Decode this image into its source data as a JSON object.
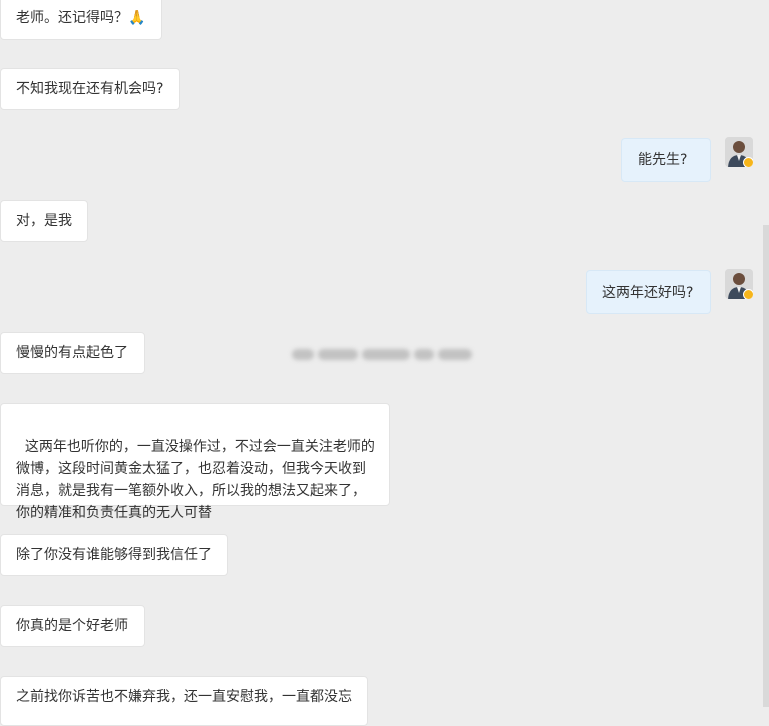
{
  "chat": {
    "messages": [
      {
        "side": "left",
        "text": "老师。还记得吗？🙏"
      },
      {
        "side": "left",
        "text": "不知我现在还有机会吗?"
      },
      {
        "side": "right",
        "text": "能先生?"
      },
      {
        "side": "left",
        "text": "对，是我"
      },
      {
        "side": "right",
        "text": "这两年还好吗?"
      },
      {
        "side": "left",
        "text": "慢慢的有点起色了"
      },
      {
        "side": "left",
        "text": "这两年也听你的，一直没操作过，不过会一直关注老师的\n微博，这段时间黄金太猛了，也忍着没动，但我今天收到\n消息，就是我有一笔额外收入，所以我的想法又起来了，\n你的精准和负责任真的无人可替"
      },
      {
        "side": "left",
        "text": "除了你没有谁能够得到我信任了"
      },
      {
        "side": "left",
        "text": "你真的是个好老师"
      },
      {
        "side": "left",
        "text": "之前找你诉苦也不嫌弃我，还一直安慰我，一直都没忘"
      }
    ]
  },
  "colors": {
    "background": "#ededed",
    "left_bubble": "#ffffff",
    "right_bubble": "#e6f2fc",
    "verify_badge": "#f6b51b"
  },
  "icons": {
    "avatar": "user-avatar-icon",
    "verify": "verified-badge-icon"
  }
}
